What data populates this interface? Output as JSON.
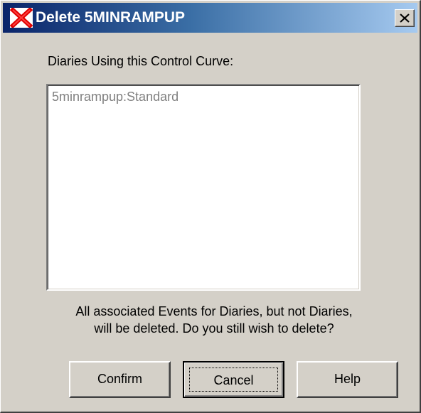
{
  "window": {
    "title": "Delete 5MINRAMPUP",
    "title_icon": "red-x-delete-icon",
    "close_icon": "close-icon"
  },
  "main": {
    "list_label": "Diaries Using this Control Curve:",
    "list_items": [
      "5minrampup:Standard"
    ],
    "message_line1": "All associated Events for Diaries, but not Diaries,",
    "message_line2": "will be deleted. Do you still wish to delete?"
  },
  "buttons": {
    "confirm": "Confirm",
    "cancel": "Cancel",
    "help": "Help"
  },
  "colors": {
    "titlebar_start": "#0a246a",
    "titlebar_end": "#a6caf0",
    "dialog_face": "#d4d0c8",
    "disabled_text": "#808080"
  }
}
